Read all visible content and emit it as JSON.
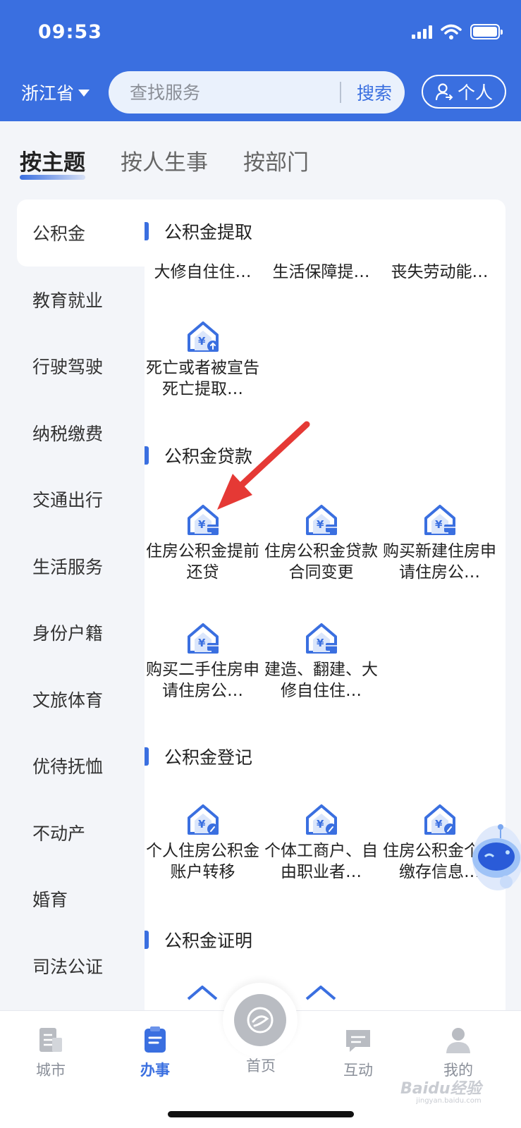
{
  "status_bar": {
    "time": "09:53"
  },
  "header": {
    "province": "浙江省",
    "search_placeholder": "查找服务",
    "search_button": "搜索",
    "personal_button": "个人"
  },
  "category_tabs": [
    "按主题",
    "按人生事",
    "按部门"
  ],
  "sidebar": {
    "items": [
      "公积金",
      "教育就业",
      "行驶驾驶",
      "纳税缴费",
      "交通出行",
      "生活服务",
      "身份户籍",
      "文旅体育",
      "优待抚恤",
      "不动产",
      "婚育",
      "司法公证"
    ]
  },
  "content": {
    "sections": [
      {
        "title": "公积金提取",
        "items": [
          "大修自住住…",
          "生活保障提…",
          "丧失劳动能…",
          "死亡或者被宣告死亡提取…"
        ]
      },
      {
        "title": "公积金贷款",
        "items": [
          "住房公积金提前还贷",
          "住房公积金贷款合同变更",
          "购买新建住房申请住房公…",
          "购买二手住房申请住房公…",
          "建造、翻建、大修自住住…"
        ]
      },
      {
        "title": "公积金登记",
        "items": [
          "个人住房公积金账户转移",
          "个体工商户、自由职业者…",
          "住房公积金个人缴存信息…"
        ]
      },
      {
        "title": "公积金证明",
        "items": []
      }
    ]
  },
  "bottom_nav": {
    "items": [
      "城市",
      "办事",
      "首页",
      "互动",
      "我的"
    ],
    "active": "办事"
  },
  "watermark": {
    "text": "Baidu经验",
    "sub": "jingyan.baidu.com"
  },
  "colors": {
    "primary": "#3a6fe0",
    "annotation_arrow": "#e53935"
  }
}
